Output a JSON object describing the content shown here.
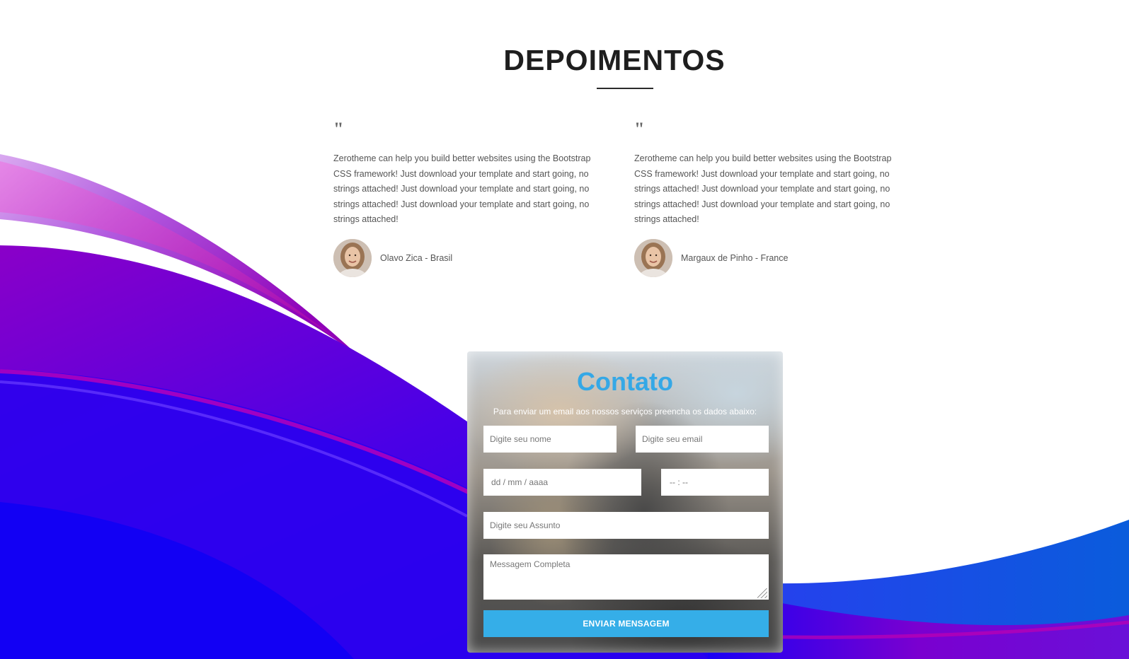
{
  "section": {
    "title": "DEPOIMENTOS"
  },
  "testimonials": [
    {
      "quote_mark": "\"",
      "text": "Zerotheme can help you build better websites using the Bootstrap CSS framework! Just download your template and start going, no strings attached! Just download your template and start going, no strings attached! Just download your template and start going, no strings attached!",
      "author": "Olavo Zica - Brasil"
    },
    {
      "quote_mark": "\"",
      "text": "Zerotheme can help you build better websites using the Bootstrap CSS framework! Just download your template and start going, no strings attached! Just download your template and start going, no strings attached! Just download your template and start going, no strings attached!",
      "author": "Margaux de Pinho - France"
    }
  ],
  "contact": {
    "title": "Contato",
    "subtitle": "Para enviar um email aos nossos serviços preencha os dados abaixo:",
    "name_placeholder": "Digite seu nome",
    "email_placeholder": "Digite seu email",
    "date_placeholder": "dd / mm / aaaa",
    "time_placeholder": "-- : --",
    "subject_placeholder": "Digite seu Assunto",
    "message_placeholder": "Messagem Completa",
    "submit_label": "ENVIAR MENSAGEM"
  },
  "colors": {
    "accent": "#35aee8",
    "title": "#1e1e1e",
    "wave_purple": "#7a00c8",
    "wave_blue": "#1a00f0",
    "wave_magenta": "#c000a8"
  }
}
